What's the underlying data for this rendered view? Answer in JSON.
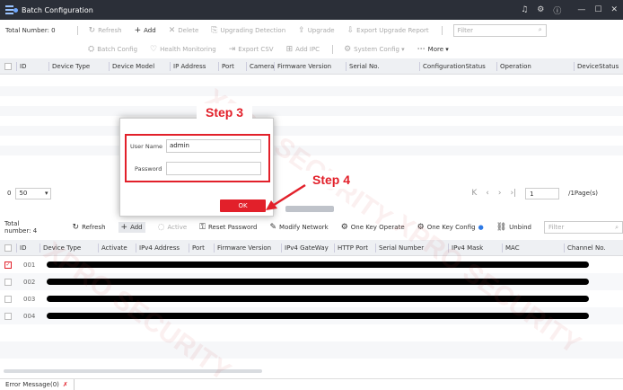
{
  "window": {
    "title": "Batch Configuration",
    "controls": [
      "bell-icon",
      "gear-icon",
      "info-icon",
      "minimize-icon",
      "maximize-icon",
      "close-icon"
    ]
  },
  "top": {
    "total_label": "Total Number: 0",
    "toolbar1": [
      {
        "icon": "↻",
        "label": "Refresh",
        "enabled": false
      },
      {
        "icon": "+",
        "label": "Add",
        "enabled": true
      },
      {
        "icon": "✕",
        "label": "Delete",
        "enabled": false
      },
      {
        "icon": "⎘",
        "label": "Upgrading Detection",
        "enabled": false
      },
      {
        "icon": "⇪",
        "label": "Upgrade",
        "enabled": false
      },
      {
        "icon": "⇩",
        "label": "Export Upgrade Report",
        "enabled": false
      }
    ],
    "filter_placeholder": "Filter",
    "toolbar2": [
      {
        "icon": "⛭",
        "label": "Batch Config",
        "enabled": false
      },
      {
        "icon": "♡",
        "label": "Health Monitoring",
        "enabled": false
      },
      {
        "icon": "⇥",
        "label": "Export CSV",
        "enabled": false
      },
      {
        "icon": "⊞",
        "label": "Add IPC",
        "enabled": false
      },
      {
        "icon": "⚙",
        "label": "System Config ▾",
        "enabled": false
      },
      {
        "icon": "⋯",
        "label": "More ▾",
        "enabled": true
      }
    ],
    "columns": [
      "ID",
      "Device Type",
      "Device Model",
      "IP Address",
      "Port",
      "Camera",
      "Firmware Version",
      "Serial No.",
      "ConfigurationStatus",
      "Operation",
      "DeviceStatus"
    ]
  },
  "pager": {
    "page_size": "50",
    "page_input": "1",
    "page_total": "/1Page(s)"
  },
  "bottom": {
    "total_label": "Total number: 4",
    "toolbar": [
      {
        "icon": "↻",
        "label": "Refresh",
        "enabled": true
      },
      {
        "icon": "+",
        "label": "Add",
        "enabled": true
      },
      {
        "icon": "◌",
        "label": "Active",
        "enabled": false
      },
      {
        "icon": "⚿",
        "label": "Reset Password",
        "enabled": true
      },
      {
        "icon": "✎",
        "label": "Modify Network",
        "enabled": true
      },
      {
        "icon": "⚙",
        "label": "One Key Operate",
        "enabled": true
      },
      {
        "icon": "⚙",
        "label": "One Key Config",
        "enabled": true
      },
      {
        "icon": "⛓",
        "label": "Unbind",
        "enabled": true
      }
    ],
    "filter_placeholder": "Filter",
    "columns": [
      "ID",
      "Device Type",
      "Activate",
      "IPv4 Address",
      "Port",
      "Firmware Version",
      "IPv4 GateWay",
      "HTTP Port",
      "Serial Number",
      "IPv4 Mask",
      "MAC",
      "Channel No."
    ],
    "rows": [
      {
        "id": "001",
        "checked": true
      },
      {
        "id": "002",
        "checked": false
      },
      {
        "id": "003",
        "checked": false
      },
      {
        "id": "004",
        "checked": false
      }
    ]
  },
  "dialog": {
    "user_label": "User Name",
    "user_value": "admin",
    "password_label": "Password",
    "password_value": "",
    "ok_label": "OK"
  },
  "annotations": {
    "step3": "Step 3",
    "step4": "Step 4",
    "color": "#e2202a"
  },
  "status": {
    "error_tab": "Error Message(0)"
  },
  "watermark": "XPRO SECURITY"
}
